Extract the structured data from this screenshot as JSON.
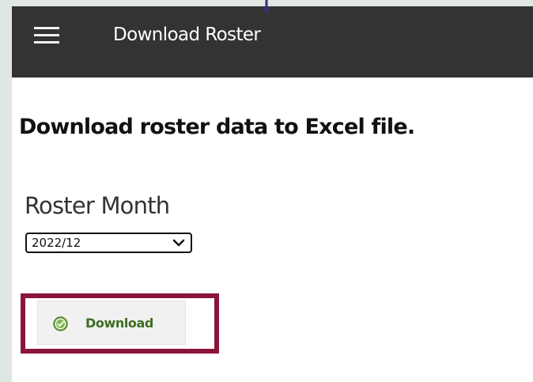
{
  "header": {
    "title": "Download Roster",
    "menu_icon": "hamburger-menu-icon",
    "background": "#333333"
  },
  "main": {
    "heading": "Download roster data to Excel file.",
    "roster_month": {
      "label": "Roster Month",
      "selected_value": "2022/12"
    },
    "download_button": {
      "label": "Download",
      "icon": "check-circle-icon",
      "label_color": "#3c6e25"
    },
    "highlight_color": "#8a1538"
  },
  "annotation": {
    "arrow_icon": "down-arrow-icon",
    "arrow_color": "#3b2f6b"
  }
}
